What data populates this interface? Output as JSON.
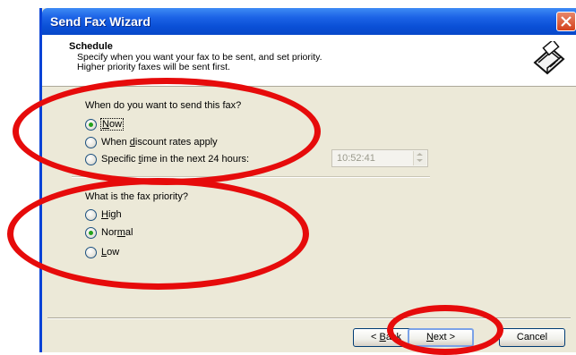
{
  "window": {
    "title": "Send Fax Wizard"
  },
  "header": {
    "title": "Schedule",
    "subtitle_line1": "Specify when you want your fax to be sent, and set priority.",
    "subtitle_line2": "Higher priority faxes will be sent first.",
    "icon": "fax-machine-icon"
  },
  "when": {
    "question": "When do you want to send this fax?",
    "options": [
      {
        "pre": "",
        "key": "N",
        "post": "ow",
        "checked": true
      },
      {
        "pre": "When ",
        "key": "d",
        "post": "iscount rates apply",
        "checked": false
      },
      {
        "pre": "Specific ",
        "key": "t",
        "post": "ime in the next 24 hours:",
        "checked": false
      }
    ],
    "time_value": "10:52:41"
  },
  "priority": {
    "question": "What is the fax priority?",
    "options": [
      {
        "pre": "",
        "key": "H",
        "post": "igh",
        "checked": false
      },
      {
        "pre": "Nor",
        "key": "m",
        "post": "al",
        "checked": true
      },
      {
        "pre": "",
        "key": "L",
        "post": "ow",
        "checked": false
      }
    ]
  },
  "buttons": {
    "back": {
      "pre": "< ",
      "key": "B",
      "post": "ack"
    },
    "next": {
      "pre": "",
      "key": "N",
      "post": "ext >"
    },
    "cancel": "Cancel"
  },
  "colors": {
    "annotation": "#e60b0b",
    "titlebar": "#0a4fd6",
    "dialog_bg": "#ece9d8"
  }
}
